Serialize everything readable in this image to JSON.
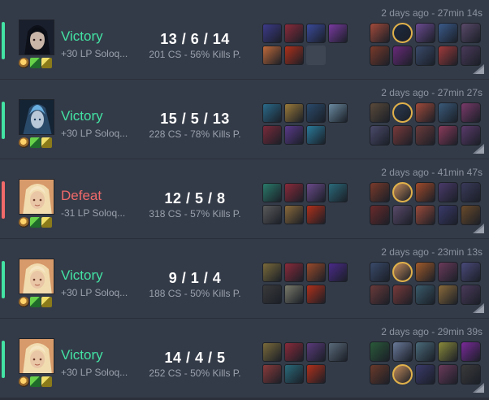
{
  "matches": [
    {
      "result": "Victory",
      "outcome": "win",
      "lp": "+30 LP Soloq...",
      "kda": "13 / 6 / 14",
      "cs": "201 CS - 56% Kills P.",
      "time": "2 days ago - 27min 14s",
      "champion_icon": "dark-haired-champion-portrait",
      "items": [
        "#3d3a8a",
        "#8a2a3a",
        "#3a4a9a",
        "#7a3aa0",
        "#c06a3a",
        "#b0301a",
        "empty"
      ],
      "team_a": [
        "#a24a3a",
        "self:#1e2a40",
        "#6a4a90",
        "#3a5a8a",
        "#5a4a6a"
      ],
      "team_b": [
        "#7a3a2a",
        "#6a2a7a",
        "#3a4a6a",
        "#a03a3a",
        "#4a3a5a"
      ]
    },
    {
      "result": "Victory",
      "outcome": "win",
      "lp": "+30 LP Soloq...",
      "kda": "15 / 5 / 13",
      "cs": "228 CS - 78% Kills P.",
      "time": "2 days ago - 27min 27s",
      "champion_icon": "blue-armored-champion-portrait",
      "items": [
        "#2a6a8a",
        "#9a7a3a",
        "#2a4a6a",
        "#6a8aa0",
        "#7a2a3a",
        "#5a3a8a",
        "#2a7a9a"
      ],
      "team_a": [
        "#5a4a3a",
        "self:#2a3a50",
        "#a04a3a",
        "#3a5a7a",
        "#7a3a6a"
      ],
      "team_b": [
        "#4a4a6a",
        "#7a3a3a",
        "#6a3a3a",
        "#8a3a5a",
        "#5a3a6a"
      ]
    },
    {
      "result": "Defeat",
      "outcome": "loss",
      "lp": "-31 LP Soloq...",
      "kda": "12 / 5 / 8",
      "cs": "318 CS - 57% Kills P.",
      "time": "2 days ago - 41min 47s",
      "champion_icon": "blonde-champion-portrait",
      "items": [
        "#2a7a6a",
        "#8a2a3a",
        "#6a4a8a",
        "#2a6a7a",
        "#5a5a5a",
        "#8a6a3a",
        "#b0301a"
      ],
      "team_a": [
        "#7a3a2a",
        "self:#c08a5a",
        "#a04a2a",
        "#4a3a6a",
        "#3a3a5a"
      ],
      "team_b": [
        "#6a2a2a",
        "#5a4a6a",
        "#9a4a3a",
        "#3a3a6a",
        "#6a4a2a"
      ]
    },
    {
      "result": "Victory",
      "outcome": "win",
      "lp": "+30 LP Soloq...",
      "kda": "9 / 1 / 4",
      "cs": "188 CS - 50% Kills P.",
      "time": "2 days ago - 23min 13s",
      "champion_icon": "blonde-champion-portrait",
      "items": [
        "#7a6a3a",
        "#8a2a3a",
        "#9a4a2a",
        "#4a2a8a",
        "#3a3a3a",
        "#7a7a6a",
        "#b0301a"
      ],
      "team_a": [
        "#3a4a6a",
        "self:#c08a5a",
        "#a05a2a",
        "#6a3a5a",
        "#4a4a7a"
      ],
      "team_b": [
        "#6a3a3a",
        "#7a3a3a",
        "#3a5a6a",
        "#8a6a3a",
        "#4a3a5a"
      ]
    },
    {
      "result": "Victory",
      "outcome": "win",
      "lp": "+30 LP Soloq...",
      "kda": "14 / 4 / 5",
      "cs": "252 CS - 50% Kills P.",
      "time": "2 days ago - 29min 39s",
      "champion_icon": "blonde-champion-portrait",
      "items": [
        "#7a6a3a",
        "#8a2a3a",
        "#5a3a7a",
        "#5a6a7a",
        "#8a3a3a",
        "#2a6a7a",
        "#b0301a"
      ],
      "team_a": [
        "#2a5a3a",
        "#6a7a9a",
        "#4a6a7a",
        "#8a8a3a",
        "#7a2a9a"
      ],
      "team_b": [
        "#6a3a2a",
        "self:#c08a5a",
        "#3a3a6a",
        "#6a3a5a",
        "#3a3a3a"
      ]
    }
  ]
}
